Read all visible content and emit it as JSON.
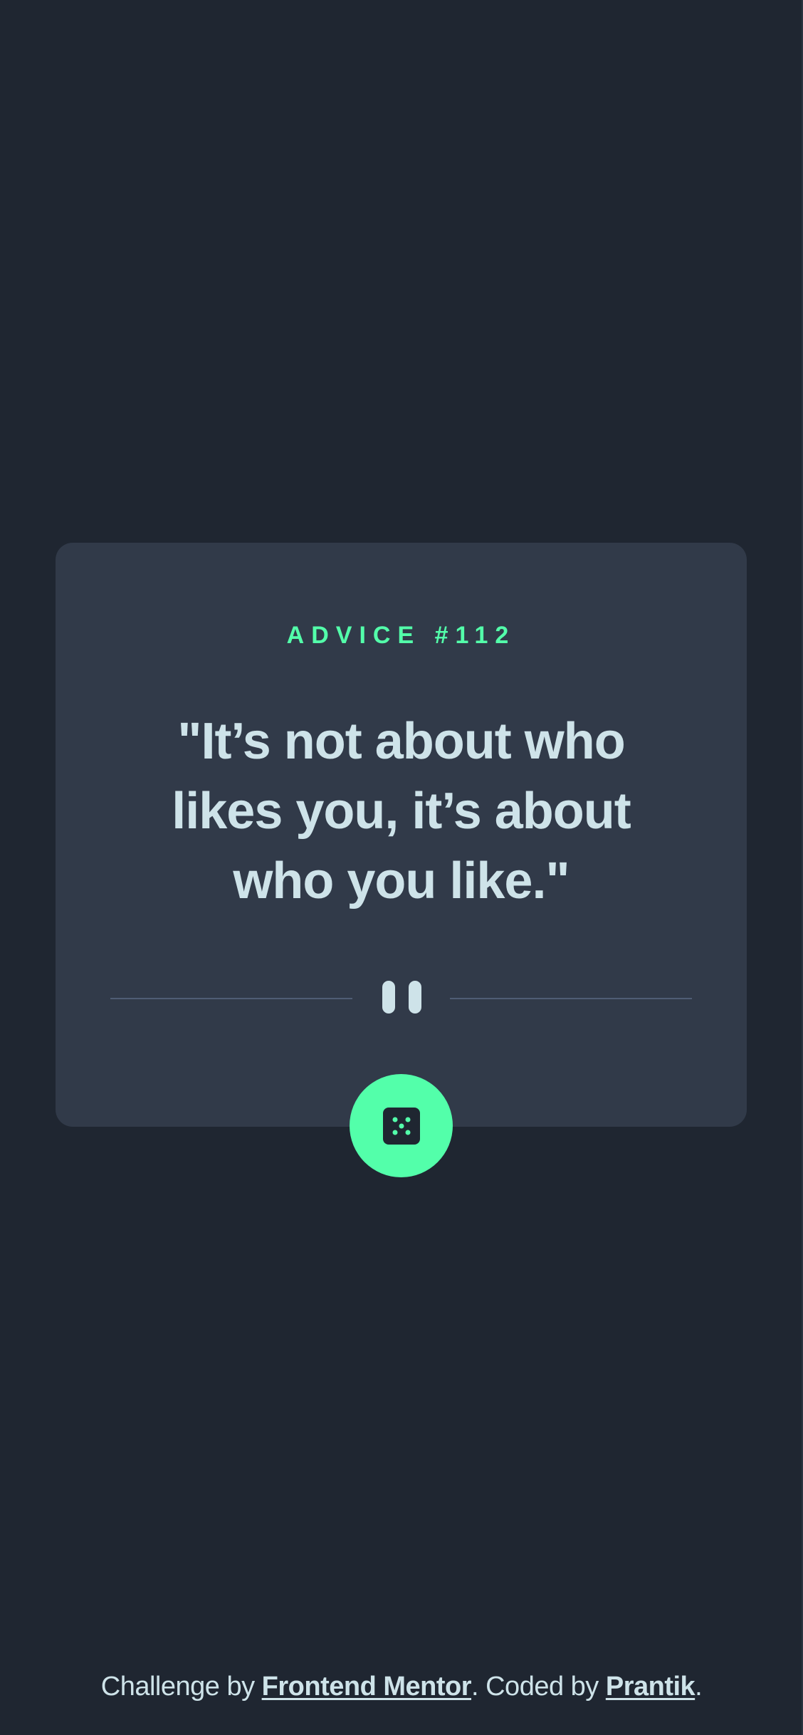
{
  "card": {
    "advice_label": "ADVICE #112",
    "quote": "\"It’s not about who likes you, it’s about who you like.\""
  },
  "icons": {
    "divider": "pause-icon",
    "button": "dice-icon"
  },
  "attribution": {
    "prefix": "Challenge by ",
    "link1": "Frontend Mentor",
    "middle": ". Coded by ",
    "link2": "Prantik",
    "suffix": "."
  },
  "colors": {
    "background": "#1f2631",
    "card": "#313a49",
    "accent": "#53ffaa",
    "text": "#cee3e9",
    "divider": "#4f5d74"
  }
}
